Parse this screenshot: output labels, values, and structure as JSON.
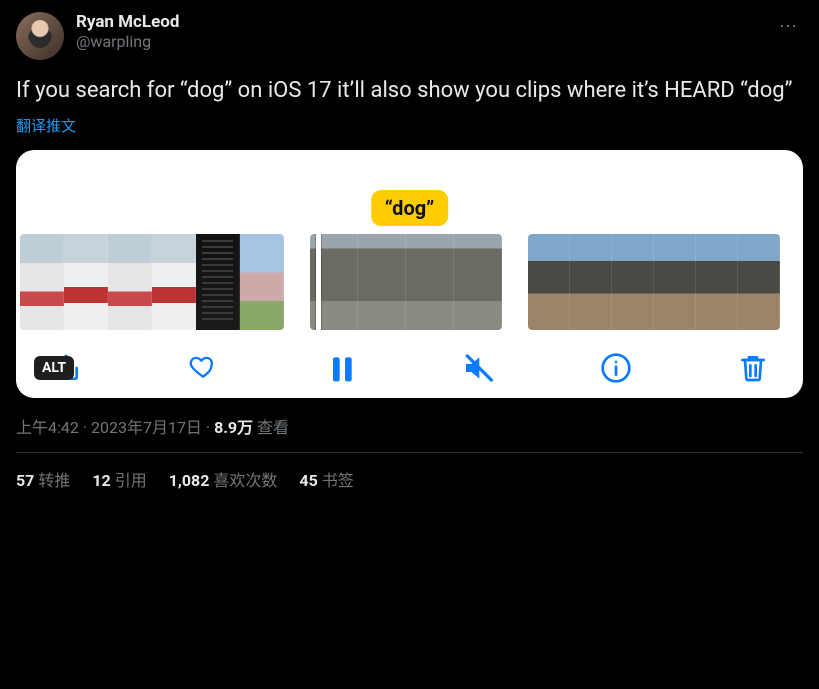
{
  "user": {
    "display_name": "Ryan McLeod",
    "username": "@warpling"
  },
  "tweet_text": "If you search for “dog” on iOS 17 it’ll also show you clips where it’s HEARD “dog”",
  "translate_label": "翻译推文",
  "media": {
    "badge_text": "“dog”",
    "alt_label": "ALT"
  },
  "meta": {
    "time": "上午4:42",
    "date": "2023年7月17日",
    "views_count": "8.9万",
    "views_label": "查看",
    "separator": " · "
  },
  "stats": {
    "retweets_count": "57",
    "retweets_label": "转推",
    "quotes_count": "12",
    "quotes_label": "引用",
    "likes_count": "1,082",
    "likes_label": "喜欢次数",
    "bookmarks_count": "45",
    "bookmarks_label": "书签"
  },
  "icons": {
    "share": "share-icon",
    "heart": "heart-icon",
    "pause": "pause-icon",
    "mute": "mute-icon",
    "info": "info-icon",
    "trash": "trash-icon",
    "more": "more-icon"
  }
}
